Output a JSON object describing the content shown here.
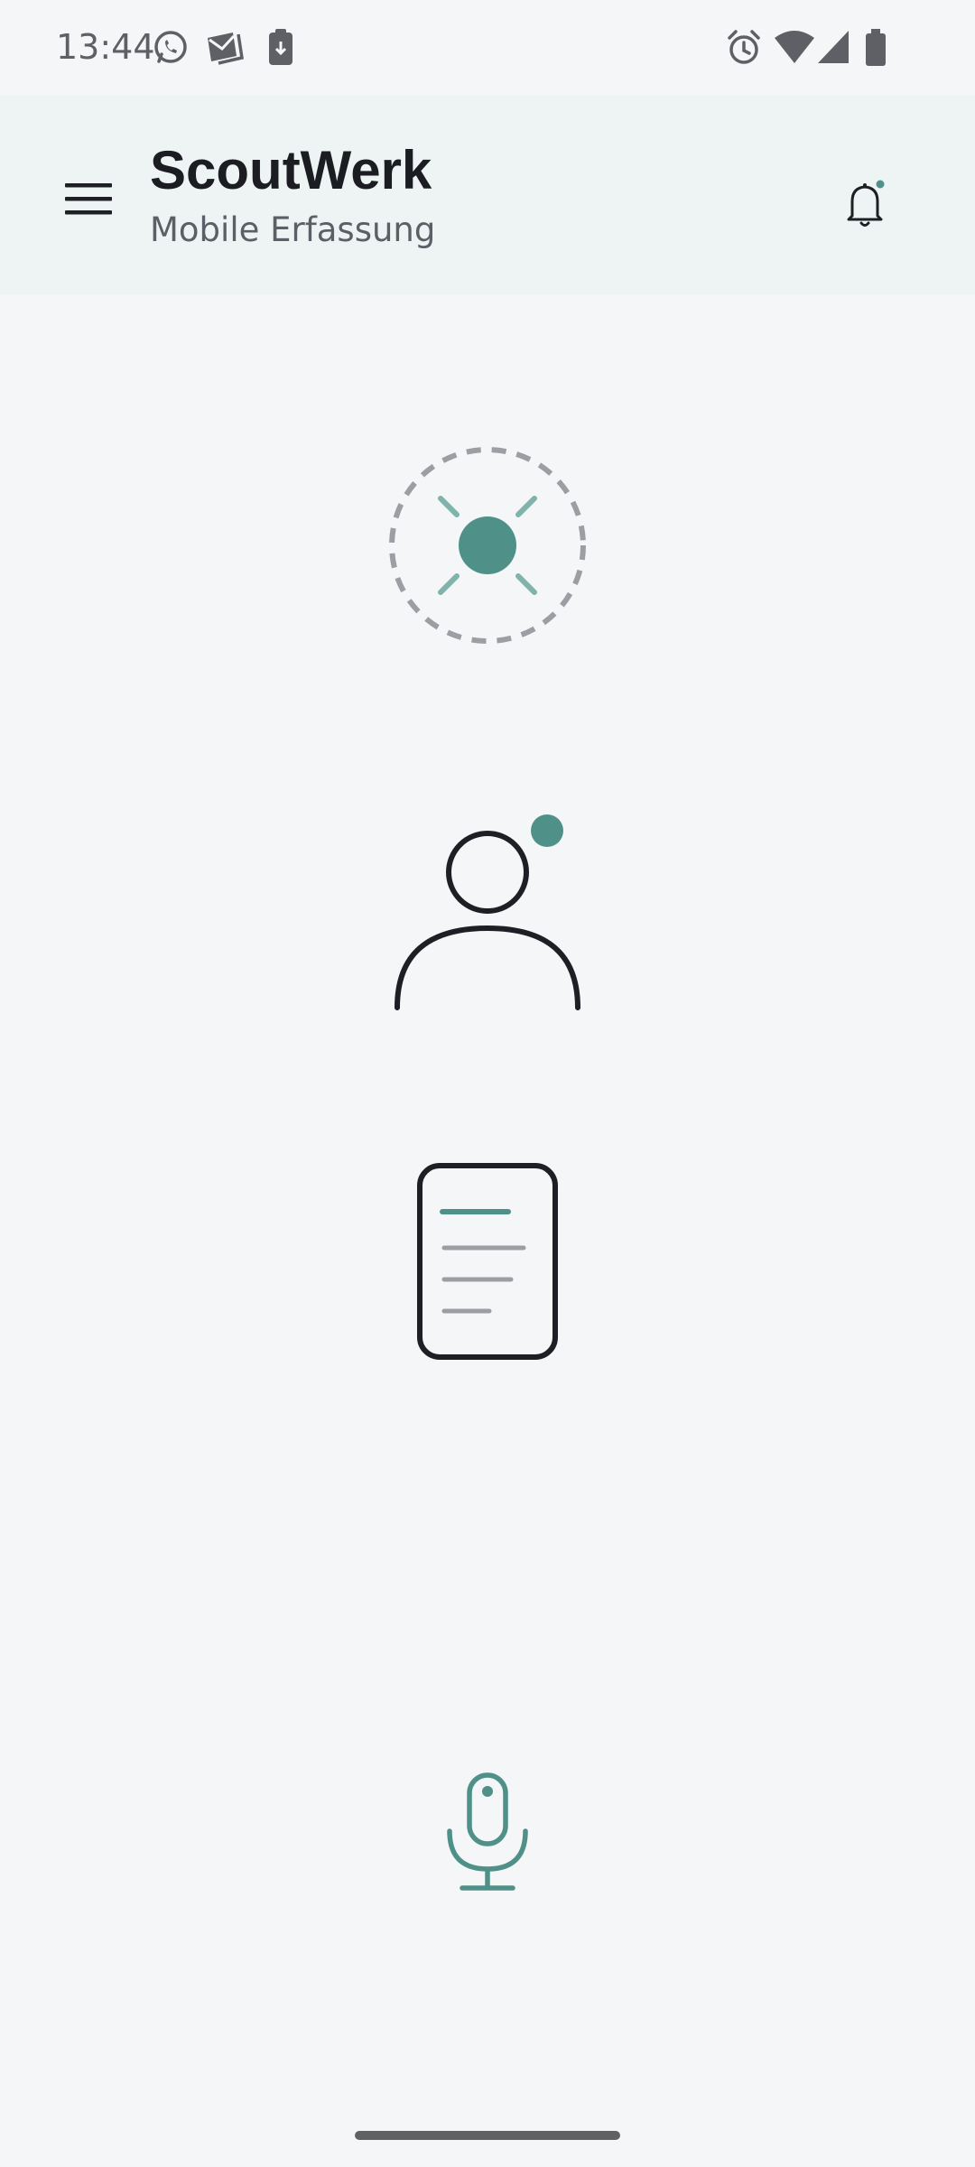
{
  "status_bar": {
    "time": "13:44",
    "left_icons": [
      "whatsapp-icon",
      "mail-stack-icon",
      "clipboard-icon"
    ],
    "right_icons": [
      "alarm-icon",
      "wifi-icon",
      "signal-icon",
      "battery-icon"
    ]
  },
  "app_bar": {
    "title": "ScoutWerk",
    "subtitle": "Mobile Erfassung",
    "menu_icon": "hamburger-menu-icon",
    "notification_icon": "bell-icon",
    "has_unread_notifications": true
  },
  "main": {
    "icons": [
      "location-target-icon",
      "user-profile-icon",
      "document-icon"
    ],
    "microphone_icon": "microphone-icon"
  },
  "colors": {
    "accent": "#4f9188",
    "accent_light": "#7fb3ac",
    "dark": "#1e1f24",
    "muted": "#9c9ea3",
    "background": "#f5f6f8",
    "app_bar_background": "#eef4f3"
  }
}
